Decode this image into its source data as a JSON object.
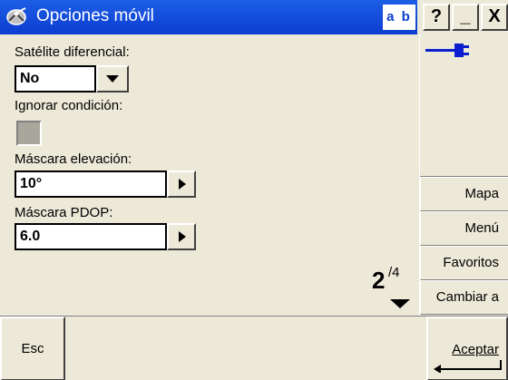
{
  "window": {
    "title": "Opciones móvil",
    "input_mode": "a b",
    "help_label": "?",
    "minimize_label": "_",
    "close_label": "X"
  },
  "fields": {
    "sat_label": "Satélite diferencial:",
    "sat_value": "No",
    "ignore_label": "Ignorar condición:",
    "ignore_checked": false,
    "elev_label": "Máscara elevación:",
    "elev_value": "10°",
    "pdop_label": "Máscara PDOP:",
    "pdop_value": "6.0"
  },
  "pager": {
    "current": "2",
    "total": "/4"
  },
  "side_buttons": [
    "Mapa",
    "Menú",
    "Favoritos",
    "Cambiar a"
  ],
  "bottom": {
    "esc_label": "Esc",
    "accept_label": "Aceptar"
  },
  "colors": {
    "title_bg": "#0b3dd0",
    "face": "#ece9d8",
    "antenna_icon": "#0b1fd0"
  },
  "icons": {
    "app": "satellite-dish-icon",
    "status": "antenna-connector-icon"
  }
}
